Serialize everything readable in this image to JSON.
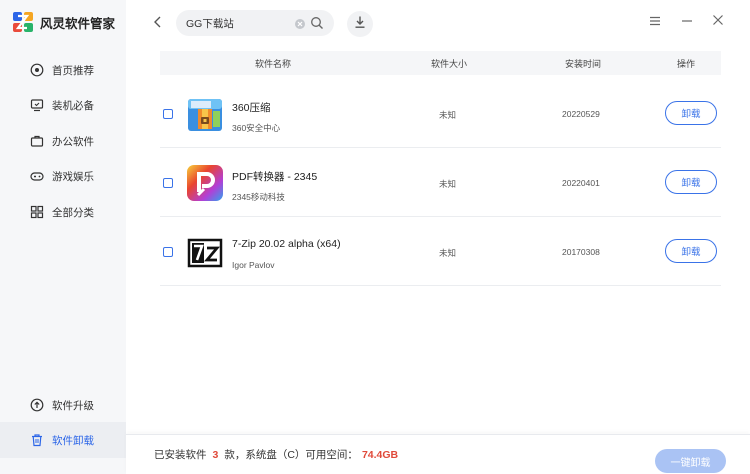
{
  "app": {
    "title": "风灵软件管家"
  },
  "sidebar": {
    "items": [
      {
        "label": "首页推荐",
        "icon": "home-icon"
      },
      {
        "label": "装机必备",
        "icon": "monitor-icon"
      },
      {
        "label": "办公软件",
        "icon": "briefcase-icon"
      },
      {
        "label": "游戏娱乐",
        "icon": "gamepad-icon"
      },
      {
        "label": "全部分类",
        "icon": "grid-icon"
      }
    ],
    "bottom_items": [
      {
        "label": "软件升级",
        "icon": "upgrade-icon"
      },
      {
        "label": "软件卸载",
        "icon": "trash-icon",
        "active": true
      }
    ]
  },
  "search": {
    "value": "GG下载站",
    "placeholder": ""
  },
  "table": {
    "headers": {
      "name": "软件名称",
      "size": "软件大小",
      "date": "安装时间",
      "action": "操作"
    },
    "rows": [
      {
        "name": "360压缩",
        "publisher": "360安全中心",
        "size": "未知",
        "date": "20220529",
        "action": "卸载",
        "icon": "360zip-app-icon"
      },
      {
        "name": "PDF转换器 - 2345",
        "publisher": "2345移动科技",
        "size": "未知",
        "date": "20220401",
        "action": "卸载",
        "icon": "pdf-converter-app-icon"
      },
      {
        "name": "7-Zip 20.02 alpha (x64)",
        "publisher": "Igor Pavlov",
        "size": "未知",
        "date": "20170308",
        "action": "卸载",
        "icon": "7zip-app-icon"
      }
    ]
  },
  "footer": {
    "installed_prefix": "已安装软件",
    "installed_count": "3",
    "installed_suffix": "款，系统盘（C）可用空间：",
    "free_space": "74.4GB",
    "uninstall_all": "一键卸载"
  },
  "colors": {
    "accent": "#2c66e8",
    "highlight": "#e04a3a",
    "disabled_button": "#aac3f4"
  }
}
